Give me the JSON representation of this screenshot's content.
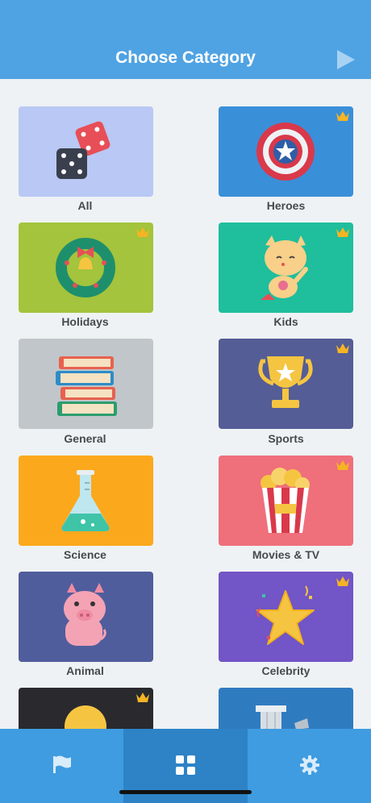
{
  "header": {
    "title": "Choose Category",
    "play_icon": "play-triangle-icon"
  },
  "categories": [
    {
      "label": "All",
      "bg": "#b9c8f4",
      "premium": false,
      "icon": "dice-icon"
    },
    {
      "label": "Heroes",
      "bg": "#3a8fd9",
      "premium": true,
      "icon": "captain-shield-icon"
    },
    {
      "label": "Holidays",
      "bg": "#a3c43c",
      "premium": true,
      "icon": "wreath-icon"
    },
    {
      "label": "Kids",
      "bg": "#1fbe9c",
      "premium": true,
      "icon": "cat-hero-icon"
    },
    {
      "label": "General",
      "bg": "#c1c6ca",
      "premium": false,
      "icon": "books-icon"
    },
    {
      "label": "Sports",
      "bg": "#545d96",
      "premium": true,
      "icon": "trophy-icon"
    },
    {
      "label": "Science",
      "bg": "#fba81d",
      "premium": false,
      "icon": "flask-icon"
    },
    {
      "label": "Movies & TV",
      "bg": "#ef6f7b",
      "premium": true,
      "icon": "popcorn-icon"
    },
    {
      "label": "Animal",
      "bg": "#505d9c",
      "premium": false,
      "icon": "pig-icon"
    },
    {
      "label": "Celebrity",
      "bg": "#7255c6",
      "premium": true,
      "icon": "star-icon"
    },
    {
      "label": "",
      "bg": "#2a2a2e",
      "premium": true,
      "icon": "lightbulb-icon"
    },
    {
      "label": "",
      "bg": "#2f7bc0",
      "premium": false,
      "icon": "column-icon"
    }
  ],
  "tabbar": {
    "tabs": [
      {
        "icon": "flag-icon",
        "active": false
      },
      {
        "icon": "grid-icon",
        "active": true
      },
      {
        "icon": "gear-icon",
        "active": false
      }
    ]
  },
  "colors": {
    "header": "#4fa3e3",
    "tabbar": "#3f9ce0",
    "tabbar_active": "#2d83c6",
    "background": "#eef2f4",
    "crown": "#f5b423"
  }
}
